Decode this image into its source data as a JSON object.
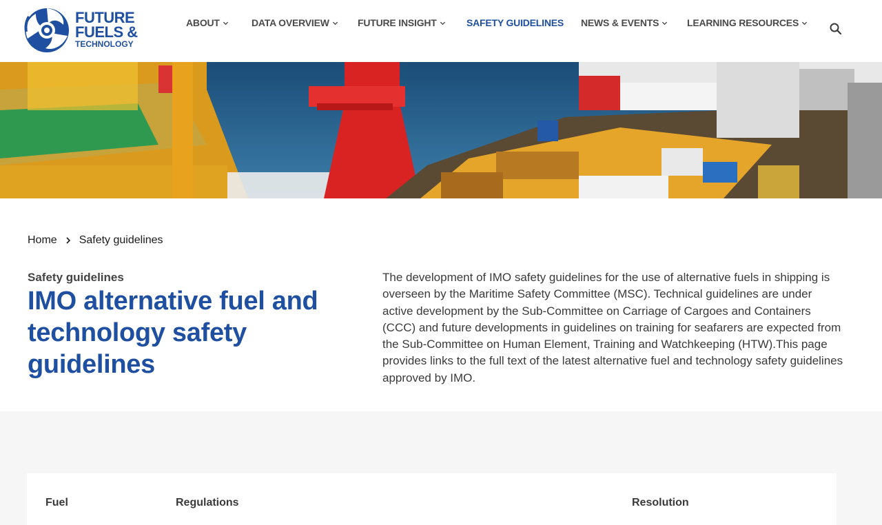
{
  "logo": {
    "line1": "FUTURE",
    "line2": "FUELS &",
    "line3": "TECHNOLOGY",
    "icon": "propeller-logo-icon",
    "brand_color": "#1f4fa0"
  },
  "nav": {
    "items": [
      {
        "label": "ABOUT",
        "has_dropdown": true
      },
      {
        "label": "DATA OVERVIEW",
        "has_dropdown": true
      },
      {
        "label": "FUTURE INSIGHT",
        "has_dropdown": true
      },
      {
        "label": "SAFETY GUIDELINES",
        "has_dropdown": false,
        "active": true
      },
      {
        "label": "NEWS & EVENTS",
        "has_dropdown": true
      },
      {
        "label": "LEARNING RESOURCES",
        "has_dropdown": true
      }
    ],
    "search_icon": "search-icon",
    "active_color": "#1f4fa0"
  },
  "hero": {
    "image": "offshore-vessel-deck-image"
  },
  "breadcrumb": {
    "home": "Home",
    "current": "Safety guidelines"
  },
  "intro": {
    "eyebrow": "Safety guidelines",
    "title": "IMO alternative fuel and technology safety guidelines",
    "body": "The development of IMO safety guidelines for the use of alternative fuels in shipping is overseen by the Maritime Safety Committee (MSC). Technical guidelines are under active development by the Sub-Committee on Carriage of Cargoes and Containers (CCC) and future developments in guidelines on training for seafarers are expected from the Sub-Committee on Human Element, Training and Watchkeeping (HTW).This page provides links to the full text of the latest alternative fuel and technology safety guidelines approved by IMO."
  },
  "table": {
    "headers": [
      "Fuel",
      "Regulations",
      "Resolution"
    ]
  }
}
